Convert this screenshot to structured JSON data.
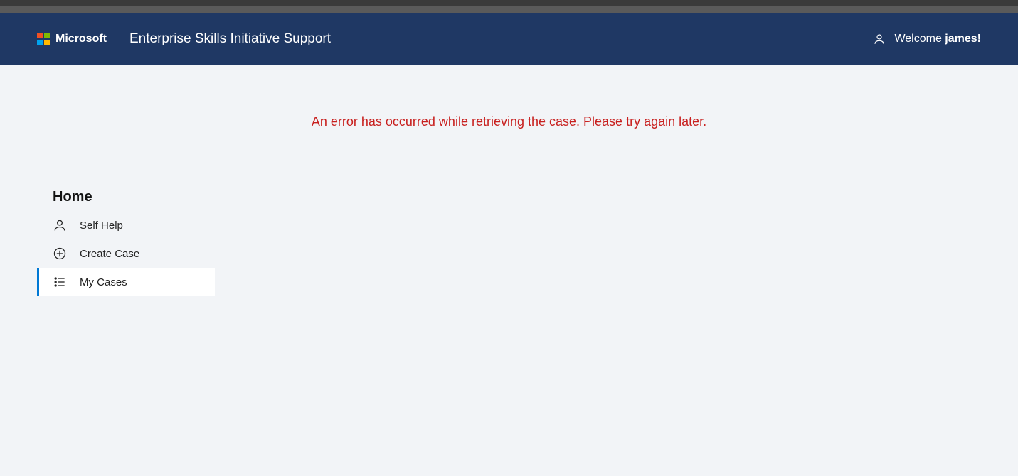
{
  "header": {
    "brand": "Microsoft",
    "title": "Enterprise Skills Initiative Support",
    "welcome_prefix": "Welcome ",
    "username": "james!"
  },
  "main": {
    "error_message": "An error has occurred while retrieving the case. Please try again later."
  },
  "sidebar": {
    "heading": "Home",
    "items": [
      {
        "label": "Self Help",
        "icon": "person",
        "active": false
      },
      {
        "label": "Create Case",
        "icon": "plus-circle",
        "active": false
      },
      {
        "label": "My Cases",
        "icon": "list",
        "active": true
      }
    ]
  }
}
